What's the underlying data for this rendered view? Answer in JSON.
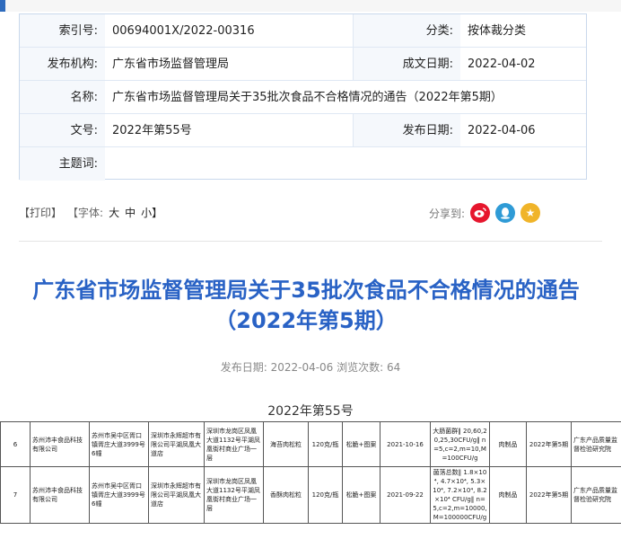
{
  "meta": {
    "index_label": "索引号:",
    "index_value": "00694001X/2022-00316",
    "category_label": "分类:",
    "category_value": "按体裁分类",
    "publisher_label": "发布机构:",
    "publisher_value": "广东省市场监督管理局",
    "written_date_label": "成文日期:",
    "written_date_value": "2022-04-02",
    "name_label": "名称:",
    "name_value": "广东省市场监督管理局关于35批次食品不合格情况的通告（2022年第5期）",
    "docno_label": "文号:",
    "docno_value": "2022年第55号",
    "publish_date_label": "发布日期:",
    "publish_date_value": "2022-04-06",
    "keywords_label": "主题词:",
    "keywords_value": ""
  },
  "toolbar": {
    "print": "【打印】",
    "font": "【字体:",
    "large": "大",
    "medium": "中",
    "small": "小】"
  },
  "share": {
    "label": "分享到:",
    "icons": [
      "weibo-icon",
      "qq-icon",
      "star-icon"
    ]
  },
  "article": {
    "title": "广东省市场监督管理局关于35批次食品不合格情况的通告（2022年第5期）",
    "pubinfo": "发布日期: 2022-04-06 浏览次数: 64",
    "docno": "2022年第55号"
  },
  "table": {
    "rows": [
      {
        "no": "6",
        "producer": "苏州沛丰食品科技有限公司",
        "producer_addr": "苏州市吴中区胥口镇胥庄大道3999号6幢",
        "seller": "深圳市永辉超市有限公司平湖凤凰大道店",
        "seller_addr": "深圳市龙岗区凤凰大道1132号平湖凤凰街村商业广场一层",
        "product": "海苔肉松粒",
        "spec": "120克/瓶",
        "brand": "松脆+图案",
        "date": "2021-10-16",
        "item": "大肠菌群‖ 20,60,20,25,30CFU/g‖ n=5,c=2,m=10,M=100CFU/g",
        "type": "肉制品",
        "issue": "2022年第5期",
        "agency": "广东产品质量监督检验研究院"
      },
      {
        "no": "7",
        "producer": "苏州沛丰食品科技有限公司",
        "producer_addr": "苏州市吴中区胥口镇胥庄大道3999号6幢",
        "seller": "深圳市永辉超市有限公司平湖凤凰大道店",
        "seller_addr": "深圳市龙岗区凤凰大道1132号平湖凤凰街村商业广场一层",
        "product": "香酥肉松粒",
        "spec": "120克/瓶",
        "brand": "松脆+图案",
        "date": "2021-09-22",
        "item": "菌落总数‖ 1.8×10⁴, 4.7×10⁴, 5.3×10⁴, 7.2×10⁴, 8.2×10⁴ CFU/g‖ n=5,c=2,m=10000,M=100000CFU/g",
        "type": "肉制品",
        "issue": "2022年第5期",
        "agency": "广东产品质量监督检验研究院"
      }
    ]
  }
}
